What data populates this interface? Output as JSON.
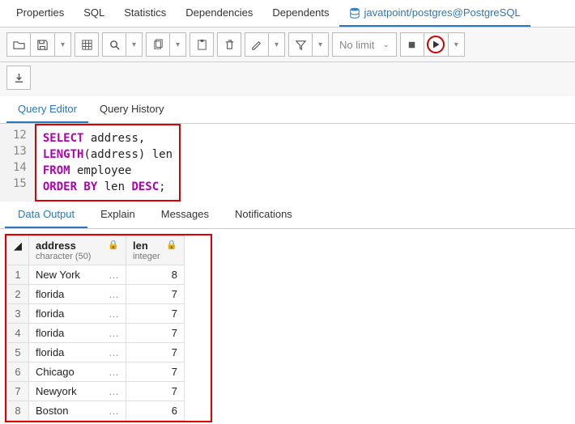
{
  "topTabs": {
    "properties": "Properties",
    "sql": "SQL",
    "statistics": "Statistics",
    "dependencies": "Dependencies",
    "dependents": "Dependents",
    "connection": "javatpoint/postgres@PostgreSQL"
  },
  "toolbar": {
    "limit": "No limit"
  },
  "panelTabs": {
    "editor": "Query Editor",
    "history": "Query History"
  },
  "editor": {
    "startLine": 12,
    "lines": [
      {
        "n": 12,
        "t": [
          [
            "kw",
            "SELECT"
          ],
          [
            "",
            " address,"
          ]
        ]
      },
      {
        "n": 13,
        "t": [
          [
            "fn",
            "LENGTH"
          ],
          [
            "",
            "(address) len"
          ]
        ]
      },
      {
        "n": 14,
        "t": [
          [
            "kw",
            "FROM"
          ],
          [
            "",
            " employee"
          ]
        ]
      },
      {
        "n": 15,
        "t": [
          [
            "kw",
            "ORDER BY"
          ],
          [
            "",
            " len "
          ],
          [
            "kw",
            "DESC"
          ],
          [
            "",
            ";"
          ]
        ]
      }
    ]
  },
  "resultTabs": {
    "data": "Data Output",
    "explain": "Explain",
    "messages": "Messages",
    "notifications": "Notifications"
  },
  "columns": [
    {
      "name": "address",
      "type": "character (50)"
    },
    {
      "name": "len",
      "type": "integer"
    }
  ],
  "rows": [
    {
      "n": 1,
      "address": "New York",
      "len": 8
    },
    {
      "n": 2,
      "address": "florida",
      "len": 7
    },
    {
      "n": 3,
      "address": "florida",
      "len": 7
    },
    {
      "n": 4,
      "address": "florida",
      "len": 7
    },
    {
      "n": 5,
      "address": "florida",
      "len": 7
    },
    {
      "n": 6,
      "address": "Chicago",
      "len": 7
    },
    {
      "n": 7,
      "address": "Newyork",
      "len": 7
    },
    {
      "n": 8,
      "address": "Boston",
      "len": 6
    }
  ],
  "chart_data": {
    "type": "table",
    "title": "LENGTH of address from employee ordered by len DESC",
    "columns": [
      "address",
      "len"
    ],
    "rows": [
      [
        "New York",
        8
      ],
      [
        "florida",
        7
      ],
      [
        "florida",
        7
      ],
      [
        "florida",
        7
      ],
      [
        "florida",
        7
      ],
      [
        "Chicago",
        7
      ],
      [
        "Newyork",
        7
      ],
      [
        "Boston",
        6
      ]
    ]
  }
}
